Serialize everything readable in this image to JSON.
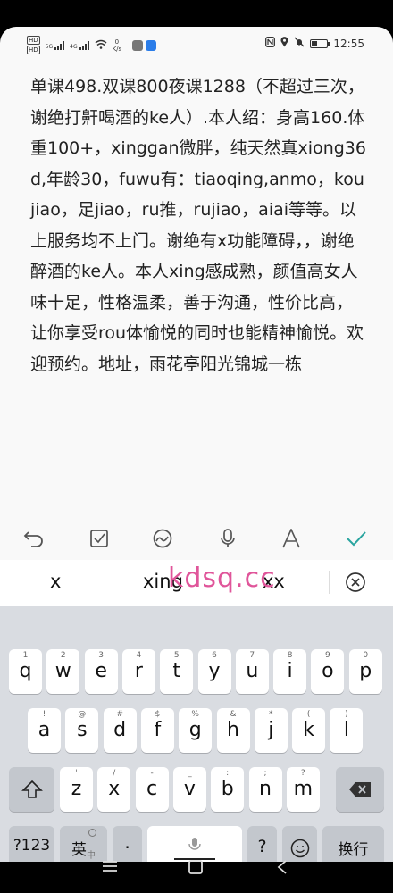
{
  "status_bar": {
    "hd1": "HD",
    "hd2": "HD",
    "net1": "5G",
    "net2": "4G",
    "speed_value": "0",
    "speed_unit": "K/s",
    "time": "12:55",
    "battery_level": 0.35
  },
  "note": {
    "content": "单课498.双课800夜课1288（不超过三次，谢绝打鼾喝酒的ke人）.本人绍：身高160.体重100+，xinggan微胖，纯天然真xiong36d,年龄30，fuwu有：tiaoqing,anmo，koujiao，足jiao，ru推，rujiao，aiai等等。以上服务均不上门。谢绝有x功能障碍，，谢绝醉酒的ke人。本人xing感成熟，颜值高女人味十足，性格温柔，善于沟通，性价比高，让你享受rou体愉悦的同时也能精神愉悦。欢迎预约。地址，雨花亭阳光锦城一栋"
  },
  "toolbar": {
    "icons": [
      "undo-icon",
      "checklist-icon",
      "sketch-icon",
      "microphone-icon",
      "text-format-icon",
      "check-icon"
    ],
    "accent": "#2aa5a0"
  },
  "suggestions": {
    "items": [
      "x",
      "xing",
      "xx"
    ]
  },
  "watermark": "kdsq.cc",
  "keyboard": {
    "row1": [
      {
        "ch": "q",
        "num": "1"
      },
      {
        "ch": "w",
        "num": "2"
      },
      {
        "ch": "e",
        "num": "3"
      },
      {
        "ch": "r",
        "num": "4"
      },
      {
        "ch": "t",
        "num": "5"
      },
      {
        "ch": "y",
        "num": "6"
      },
      {
        "ch": "u",
        "num": "7"
      },
      {
        "ch": "i",
        "num": "8"
      },
      {
        "ch": "o",
        "num": "9"
      },
      {
        "ch": "p",
        "num": "0"
      }
    ],
    "row2": [
      {
        "ch": "a",
        "num": "!"
      },
      {
        "ch": "s",
        "num": "@"
      },
      {
        "ch": "d",
        "num": "#"
      },
      {
        "ch": "f",
        "num": "$"
      },
      {
        "ch": "g",
        "num": "%"
      },
      {
        "ch": "h",
        "num": "&"
      },
      {
        "ch": "j",
        "num": "*"
      },
      {
        "ch": "k",
        "num": "("
      },
      {
        "ch": "l",
        "num": ")"
      }
    ],
    "row3": [
      {
        "ch": "z",
        "num": "'"
      },
      {
        "ch": "x",
        "num": "/"
      },
      {
        "ch": "c",
        "num": "-"
      },
      {
        "ch": "v",
        "num": "_"
      },
      {
        "ch": "b",
        "num": ":"
      },
      {
        "ch": "n",
        "num": ";"
      },
      {
        "ch": "m",
        "num": "?"
      }
    ],
    "num_key": "?123",
    "lang_key": "英",
    "lang_sub": "中",
    "dot_key": "·",
    "question_key": "?",
    "enter_key": "换行"
  },
  "nav": {
    "icons": [
      "menu-icon",
      "home-icon",
      "back-icon"
    ]
  }
}
